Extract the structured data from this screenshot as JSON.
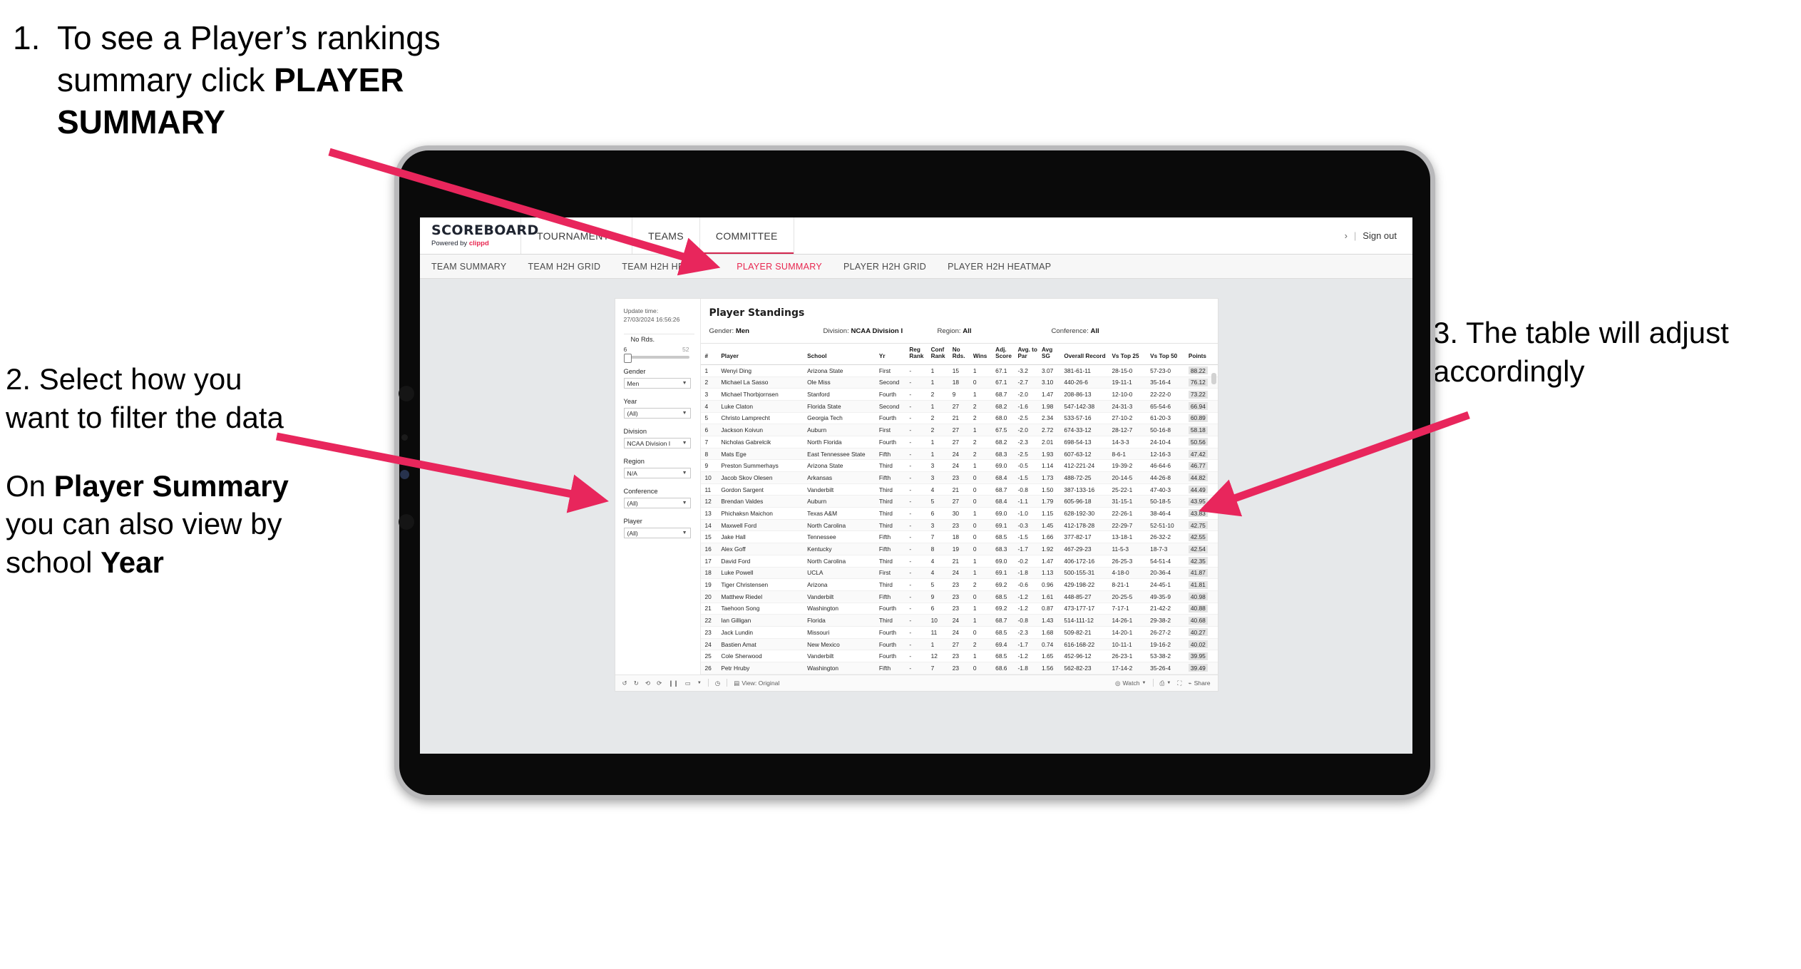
{
  "annotations": {
    "step1": {
      "number": "1.",
      "text_plain_a": "To see a Player’s rankings summary click ",
      "text_bold": "PLAYER SUMMARY"
    },
    "step2": {
      "line1": "2. Select how you want to filter the data",
      "line2_a": "On ",
      "line2_b": "Player Summary",
      "line2_c": " you can also view by school ",
      "line2_d": "Year"
    },
    "step3": {
      "text": "3. The table will adjust accordingly"
    }
  },
  "accent_color": "#e8264f",
  "arrow_color": "#e8265c",
  "app": {
    "logo": {
      "title": "SCOREBOARD",
      "powered_prefix": "Powered by ",
      "powered_brand": "clippd"
    },
    "top_nav": [
      {
        "label": "TOURNAMENTS",
        "selected": false
      },
      {
        "label": "TEAMS",
        "selected": false
      },
      {
        "label": "COMMITTEE",
        "selected": true
      }
    ],
    "top_right": {
      "chevron": "›",
      "divider": "|",
      "sign_out": "Sign out"
    },
    "sub_nav": [
      {
        "label": "TEAM SUMMARY",
        "active": false
      },
      {
        "label": "TEAM H2H GRID",
        "active": false
      },
      {
        "label": "TEAM H2H HEATMAP",
        "active": false
      },
      {
        "label": "PLAYER SUMMARY",
        "active": true
      },
      {
        "label": "PLAYER H2H GRID",
        "active": false
      },
      {
        "label": "PLAYER H2H HEATMAP",
        "active": false
      }
    ]
  },
  "filters": {
    "update_time_label": "Update time:",
    "update_time_value": "27/03/2024 16:56:26",
    "slider": {
      "label": "No Rds.",
      "min": "6",
      "max": "52"
    },
    "controls": [
      {
        "label": "Gender",
        "value": "Men"
      },
      {
        "label": "Year",
        "value": "(All)"
      },
      {
        "label": "Division",
        "value": "NCAA Division I"
      },
      {
        "label": "Region",
        "value": "N/A"
      },
      {
        "label": "Conference",
        "value": "(All)"
      },
      {
        "label": "Player",
        "value": "(All)"
      }
    ]
  },
  "viz": {
    "title": "Player Standings",
    "summary": [
      {
        "label": "Gender:",
        "value": "Men"
      },
      {
        "label": "Division:",
        "value": "NCAA Division I"
      },
      {
        "label": "Region:",
        "value": "All"
      },
      {
        "label": "Conference:",
        "value": "All"
      }
    ],
    "columns": [
      "#",
      "Player",
      "School",
      "Yr",
      "Reg Rank",
      "Conf Rank",
      "No Rds.",
      "Wins",
      "Adj. Score",
      "Avg. to Par",
      "Avg SG",
      "Overall Record",
      "Vs Top 25",
      "Vs Top 50",
      "Points"
    ],
    "rows": [
      [
        "1",
        "Wenyi Ding",
        "Arizona State",
        "First",
        "-",
        "1",
        "15",
        "1",
        "67.1",
        "-3.2",
        "3.07",
        "381-61-11",
        "28-15-0",
        "57-23-0",
        "88.22"
      ],
      [
        "2",
        "Michael La Sasso",
        "Ole Miss",
        "Second",
        "-",
        "1",
        "18",
        "0",
        "67.1",
        "-2.7",
        "3.10",
        "440-26-6",
        "19-11-1",
        "35-16-4",
        "76.12"
      ],
      [
        "3",
        "Michael Thorbjornsen",
        "Stanford",
        "Fourth",
        "-",
        "2",
        "9",
        "1",
        "68.7",
        "-2.0",
        "1.47",
        "208-86-13",
        "12-10-0",
        "22-22-0",
        "73.22"
      ],
      [
        "4",
        "Luke Claton",
        "Florida State",
        "Second",
        "-",
        "1",
        "27",
        "2",
        "68.2",
        "-1.6",
        "1.98",
        "547-142-38",
        "24-31-3",
        "65-54-6",
        "66.94"
      ],
      [
        "5",
        "Christo Lamprecht",
        "Georgia Tech",
        "Fourth",
        "-",
        "2",
        "21",
        "2",
        "68.0",
        "-2.5",
        "2.34",
        "533-57-16",
        "27-10-2",
        "61-20-3",
        "60.89"
      ],
      [
        "6",
        "Jackson Koivun",
        "Auburn",
        "First",
        "-",
        "2",
        "27",
        "1",
        "67.5",
        "-2.0",
        "2.72",
        "674-33-12",
        "28-12-7",
        "50-16-8",
        "58.18"
      ],
      [
        "7",
        "Nicholas Gabrelcik",
        "North Florida",
        "Fourth",
        "-",
        "1",
        "27",
        "2",
        "68.2",
        "-2.3",
        "2.01",
        "698-54-13",
        "14-3-3",
        "24-10-4",
        "50.56"
      ],
      [
        "8",
        "Mats Ege",
        "East Tennessee State",
        "Fifth",
        "-",
        "1",
        "24",
        "2",
        "68.3",
        "-2.5",
        "1.93",
        "607-63-12",
        "8-6-1",
        "12-16-3",
        "47.42"
      ],
      [
        "9",
        "Preston Summerhays",
        "Arizona State",
        "Third",
        "-",
        "3",
        "24",
        "1",
        "69.0",
        "-0.5",
        "1.14",
        "412-221-24",
        "19-39-2",
        "46-64-6",
        "46.77"
      ],
      [
        "10",
        "Jacob Skov Olesen",
        "Arkansas",
        "Fifth",
        "-",
        "3",
        "23",
        "0",
        "68.4",
        "-1.5",
        "1.73",
        "488-72-25",
        "20-14-5",
        "44-26-8",
        "44.82"
      ],
      [
        "11",
        "Gordon Sargent",
        "Vanderbilt",
        "Third",
        "-",
        "4",
        "21",
        "0",
        "68.7",
        "-0.8",
        "1.50",
        "387-133-16",
        "25-22-1",
        "47-40-3",
        "44.49"
      ],
      [
        "12",
        "Brendan Valdes",
        "Auburn",
        "Third",
        "-",
        "5",
        "27",
        "0",
        "68.4",
        "-1.1",
        "1.79",
        "605-96-18",
        "31-15-1",
        "50-18-5",
        "43.95"
      ],
      [
        "13",
        "Phichaksn Maichon",
        "Texas A&M",
        "Third",
        "-",
        "6",
        "30",
        "1",
        "69.0",
        "-1.0",
        "1.15",
        "628-192-30",
        "22-26-1",
        "38-46-4",
        "43.83"
      ],
      [
        "14",
        "Maxwell Ford",
        "North Carolina",
        "Third",
        "-",
        "3",
        "23",
        "0",
        "69.1",
        "-0.3",
        "1.45",
        "412-178-28",
        "22-29-7",
        "52-51-10",
        "42.75"
      ],
      [
        "15",
        "Jake Hall",
        "Tennessee",
        "Fifth",
        "-",
        "7",
        "18",
        "0",
        "68.5",
        "-1.5",
        "1.66",
        "377-82-17",
        "13-18-1",
        "26-32-2",
        "42.55"
      ],
      [
        "16",
        "Alex Goff",
        "Kentucky",
        "Fifth",
        "-",
        "8",
        "19",
        "0",
        "68.3",
        "-1.7",
        "1.92",
        "467-29-23",
        "11-5-3",
        "18-7-3",
        "42.54"
      ],
      [
        "17",
        "David Ford",
        "North Carolina",
        "Third",
        "-",
        "4",
        "21",
        "1",
        "69.0",
        "-0.2",
        "1.47",
        "406-172-16",
        "26-25-3",
        "54-51-4",
        "42.35"
      ],
      [
        "18",
        "Luke Powell",
        "UCLA",
        "First",
        "-",
        "4",
        "24",
        "1",
        "69.1",
        "-1.8",
        "1.13",
        "500-155-31",
        "4-18-0",
        "20-36-4",
        "41.87"
      ],
      [
        "19",
        "Tiger Christensen",
        "Arizona",
        "Third",
        "-",
        "5",
        "23",
        "2",
        "69.2",
        "-0.6",
        "0.96",
        "429-198-22",
        "8-21-1",
        "24-45-1",
        "41.81"
      ],
      [
        "20",
        "Matthew Riedel",
        "Vanderbilt",
        "Fifth",
        "-",
        "9",
        "23",
        "0",
        "68.5",
        "-1.2",
        "1.61",
        "448-85-27",
        "20-25-5",
        "49-35-9",
        "40.98"
      ],
      [
        "21",
        "Taehoon Song",
        "Washington",
        "Fourth",
        "-",
        "6",
        "23",
        "1",
        "69.2",
        "-1.2",
        "0.87",
        "473-177-17",
        "7-17-1",
        "21-42-2",
        "40.88"
      ],
      [
        "22",
        "Ian Gilligan",
        "Florida",
        "Third",
        "-",
        "10",
        "24",
        "1",
        "68.7",
        "-0.8",
        "1.43",
        "514-111-12",
        "14-26-1",
        "29-38-2",
        "40.68"
      ],
      [
        "23",
        "Jack Lundin",
        "Missouri",
        "Fourth",
        "-",
        "11",
        "24",
        "0",
        "68.5",
        "-2.3",
        "1.68",
        "509-82-21",
        "14-20-1",
        "26-27-2",
        "40.27"
      ],
      [
        "24",
        "Bastien Amat",
        "New Mexico",
        "Fourth",
        "-",
        "1",
        "27",
        "2",
        "69.4",
        "-1.7",
        "0.74",
        "616-168-22",
        "10-11-1",
        "19-16-2",
        "40.02"
      ],
      [
        "25",
        "Cole Sherwood",
        "Vanderbilt",
        "Fourth",
        "-",
        "12",
        "23",
        "1",
        "68.5",
        "-1.2",
        "1.65",
        "452-96-12",
        "26-23-1",
        "53-38-2",
        "39.95"
      ],
      [
        "26",
        "Petr Hruby",
        "Washington",
        "Fifth",
        "-",
        "7",
        "23",
        "0",
        "68.6",
        "-1.8",
        "1.56",
        "562-82-23",
        "17-14-2",
        "35-26-4",
        "39.49"
      ]
    ]
  },
  "toolbar": {
    "view_label": "View: Original",
    "watch_label": "Watch",
    "share_label": "Share",
    "icons": [
      "undo-icon",
      "redo-icon",
      "revert-icon",
      "refresh-icon",
      "pause-icon",
      "device-layout-icon",
      "eye-icon",
      "download-icon",
      "fullscreen-icon",
      "share-icon"
    ]
  }
}
